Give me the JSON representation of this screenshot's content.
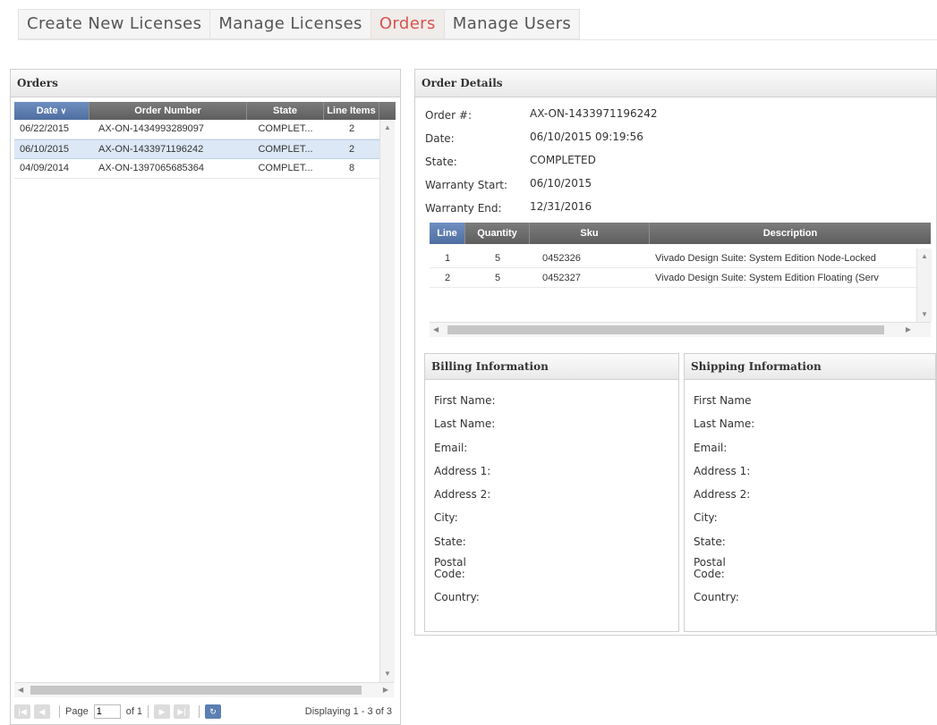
{
  "tabs": [
    {
      "label": "Create New Licenses"
    },
    {
      "label": "Manage Licenses"
    },
    {
      "label": "Orders"
    },
    {
      "label": "Manage Users"
    }
  ],
  "active_tab": "Orders",
  "orders": {
    "title": "Orders",
    "columns": [
      "Date",
      "Order Number",
      "State",
      "Line Items"
    ],
    "sort_column": "Date",
    "rows": [
      {
        "date": "06/22/2015",
        "number": "AX-ON-1434993289097",
        "state": "COMPLET...",
        "items": "2"
      },
      {
        "date": "06/10/2015",
        "number": "AX-ON-1433971196242",
        "state": "COMPLET...",
        "items": "2"
      },
      {
        "date": "04/09/2014",
        "number": "AX-ON-1397065685364",
        "state": "COMPLET...",
        "items": "8"
      }
    ],
    "selected_row": 1,
    "pager": {
      "page_label": "Page",
      "page_value": "1",
      "of_label": "of 1",
      "display_text": "Displaying 1 - 3 of 3"
    }
  },
  "details": {
    "title": "Order Details",
    "fields": [
      {
        "label": "Order #:",
        "value": "AX-ON-1433971196242"
      },
      {
        "label": "Date:",
        "value": "06/10/2015 09:19:56"
      },
      {
        "label": "State:",
        "value": "COMPLETED"
      },
      {
        "label": "Warranty Start:",
        "value": "06/10/2015"
      },
      {
        "label": "Warranty End:",
        "value": "12/31/2016"
      }
    ],
    "line_columns": [
      "Line",
      "Quantity",
      "Sku",
      "Description"
    ],
    "lines": [
      {
        "line": "1",
        "qty": "5",
        "sku": "0452326",
        "desc": "Vivado Design Suite: System Edition Node-Locked"
      },
      {
        "line": "2",
        "qty": "5",
        "sku": "0452327",
        "desc": "Vivado Design Suite: System Edition Floating (Serv"
      }
    ]
  },
  "billing": {
    "title": "Billing Information",
    "fields": [
      "First Name:",
      "Last Name:",
      "Email:",
      "Address 1:",
      "Address 2:",
      "City:",
      "State:",
      "Postal",
      "Code:",
      "Country:"
    ]
  },
  "shipping": {
    "title": "Shipping Information",
    "fields": [
      "First Name",
      "Last Name:",
      "Email:",
      "Address 1:",
      "Address 2:",
      "City:",
      "State:",
      "Postal",
      "Code:",
      "Country:"
    ]
  },
  "colors": {
    "active_tab": "#d9534f",
    "grid_header": "#6b6b6b",
    "selected_row": "#dce8f6"
  }
}
